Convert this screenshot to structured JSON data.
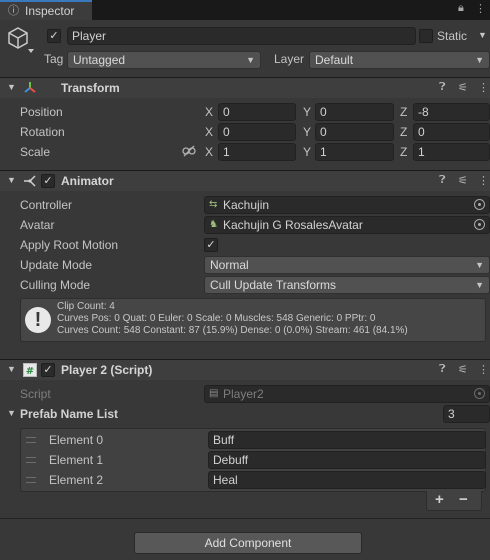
{
  "tab": {
    "label": "Inspector"
  },
  "header": {
    "name": "Player",
    "static_label": "Static",
    "tag_label": "Tag",
    "tag_value": "Untagged",
    "layer_label": "Layer",
    "layer_value": "Default"
  },
  "transform": {
    "title": "Transform",
    "rows": [
      {
        "label": "Position",
        "x": "0",
        "y": "0",
        "z": "-8"
      },
      {
        "label": "Rotation",
        "x": "0",
        "y": "0",
        "z": "0"
      },
      {
        "label": "Scale",
        "x": "1",
        "y": "1",
        "z": "1"
      }
    ],
    "axis": {
      "x": "X",
      "y": "Y",
      "z": "Z"
    }
  },
  "animator": {
    "title": "Animator",
    "controller_label": "Controller",
    "controller_value": "Kachujin",
    "avatar_label": "Avatar",
    "avatar_value": "Kachujin G RosalesAvatar",
    "apply_root_motion_label": "Apply Root Motion",
    "update_mode_label": "Update Mode",
    "update_mode_value": "Normal",
    "culling_mode_label": "Culling Mode",
    "culling_mode_value": "Cull Update Transforms",
    "info": {
      "line1": "Clip Count: 4",
      "line2": "Curves Pos: 0 Quat: 0 Euler: 0 Scale: 0 Muscles: 548 Generic: 0 PPtr: 0",
      "line3": "Curves Count: 548 Constant: 87 (15.9%) Dense: 0 (0.0%) Stream: 461 (84.1%)"
    }
  },
  "script": {
    "title": "Player 2 (Script)",
    "script_label": "Script",
    "script_value": "Player2",
    "list_label": "Prefab Name List",
    "list_size": "3",
    "elements": [
      {
        "label": "Element 0",
        "value": "Buff"
      },
      {
        "label": "Element 1",
        "value": "Debuff"
      },
      {
        "label": "Element 2",
        "value": "Heal"
      }
    ]
  },
  "add_component_label": "Add Component",
  "colors": {
    "accent": "#3a79bb",
    "background": "#383838"
  }
}
